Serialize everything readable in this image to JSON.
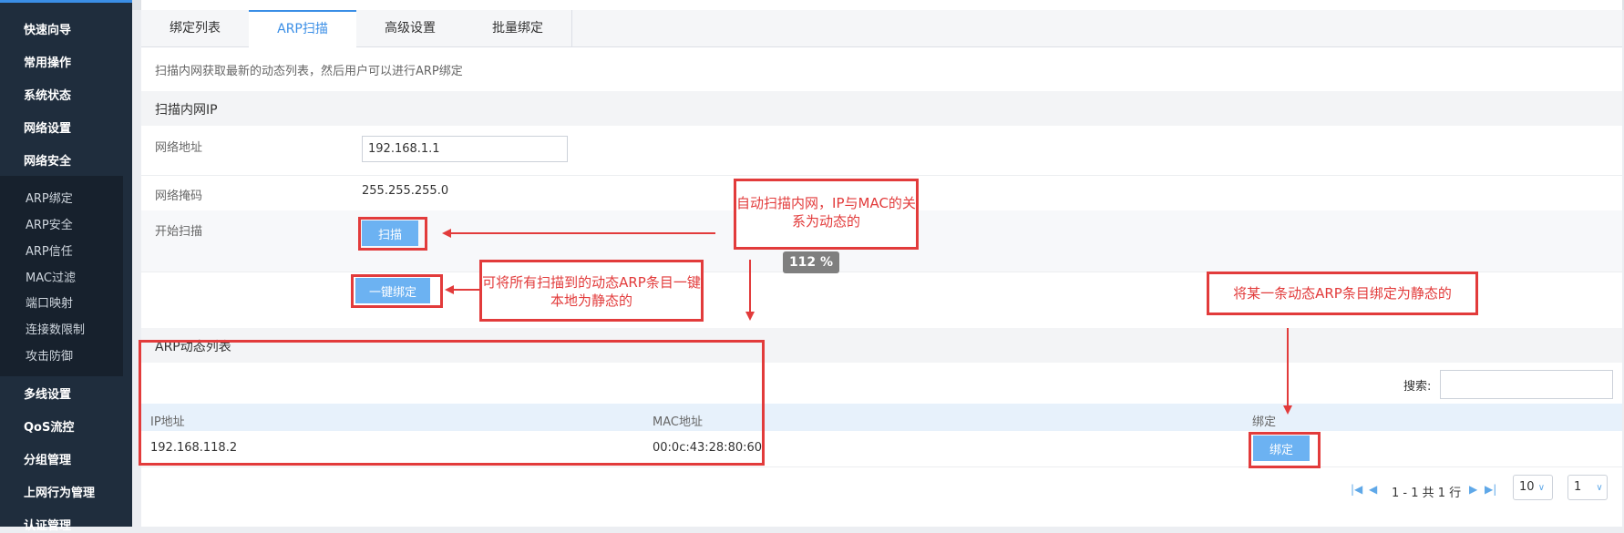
{
  "sidebar": {
    "items": [
      "快速向导",
      "常用操作",
      "系统状态",
      "网络设置",
      "网络安全"
    ],
    "submenu": [
      "ARP绑定",
      "ARP安全",
      "ARP信任",
      "MAC过滤",
      "端口映射",
      "连接数限制",
      "攻击防御"
    ],
    "items_after": [
      "多线设置",
      "QoS流控",
      "分组管理",
      "上网行为管理",
      "认证管理"
    ]
  },
  "tabs": [
    {
      "label": "绑定列表",
      "active": false
    },
    {
      "label": "ARP扫描",
      "active": true
    },
    {
      "label": "高级设置",
      "active": false
    },
    {
      "label": "批量绑定",
      "active": false
    }
  ],
  "page": {
    "description": "扫描内网获取最新的动态列表，然后用户可以进行ARP绑定",
    "section_scan": "扫描内网IP",
    "network_address_label": "网络地址",
    "network_address_value": "192.168.1.1",
    "netmask_label": "网络掩码",
    "netmask_value": "255.255.255.0",
    "start_scan_label": "开始扫描",
    "scan_button": "扫描",
    "bind_all_button": "一键绑定",
    "section_arp": "ARP动态列表",
    "search_label": "搜索:",
    "search_value": ""
  },
  "table": {
    "headers": [
      "IP地址",
      "MAC地址",
      "绑定"
    ],
    "rows": [
      {
        "ip": "192.168.118.2",
        "mac": "00:0c:43:28:80:60",
        "action": "绑定"
      }
    ]
  },
  "pager": {
    "text": "1 - 1 共 1 行",
    "page_size": "10",
    "page": "1"
  },
  "annotations": {
    "scan_note": "自动扫描内网，IP与MAC的关系为动态的",
    "bind_all_note": "可将所有扫描到的动态ARP条目一键本地为静态的",
    "bind_one_note": "将某一条动态ARP条目绑定为静态的",
    "zoom": "112 %"
  },
  "colors": {
    "accent": "#3a8ee6",
    "button": "#6cb2f2",
    "annotation": "#e23b3b",
    "sidebar": "#1f2d3d"
  }
}
